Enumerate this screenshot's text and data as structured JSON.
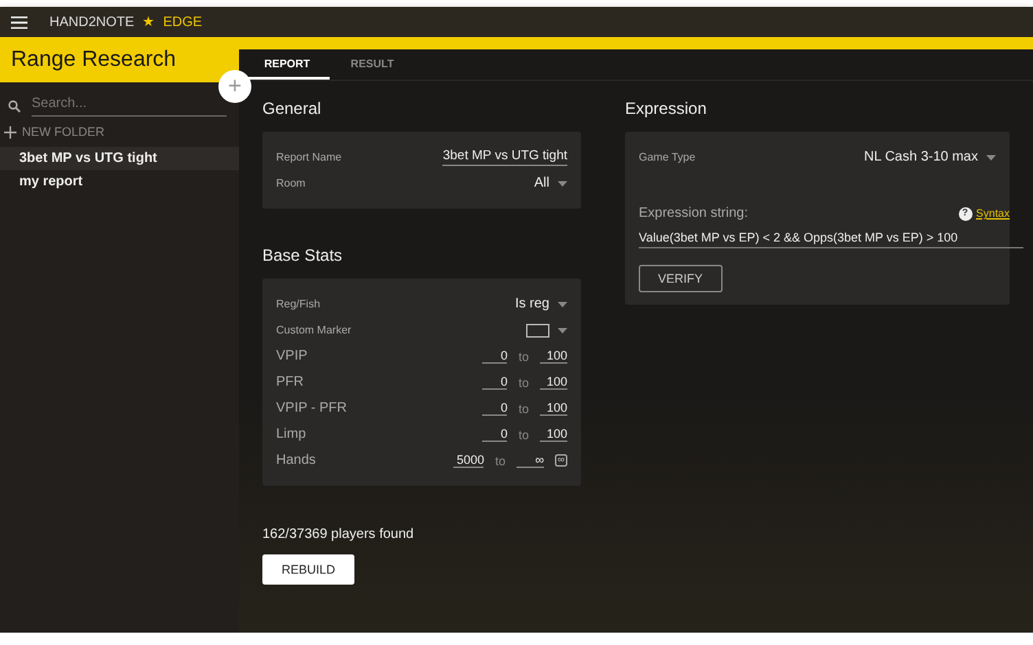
{
  "app": {
    "brand": "HAND2NOTE",
    "star": "★",
    "edition": "EDGE"
  },
  "sidebar": {
    "title": "Range Research",
    "add": "+",
    "search": {
      "placeholder": "Search..."
    },
    "new_folder": "NEW FOLDER",
    "items": [
      {
        "label": "3bet MP vs UTG tight",
        "selected": true
      },
      {
        "label": "my report",
        "selected": false
      }
    ]
  },
  "tabs": [
    {
      "label": "REPORT",
      "selected": true
    },
    {
      "label": "RESULT",
      "selected": false
    }
  ],
  "general": {
    "title": "General",
    "rows": [
      {
        "kind": "text",
        "label": "Report Name",
        "value": "3bet MP vs UTG tight"
      },
      {
        "kind": "select",
        "label": "Room",
        "value": "All"
      }
    ]
  },
  "base_stats": {
    "title": "Base Stats",
    "rows": [
      {
        "kind": "select",
        "label": "Reg/Fish",
        "value": "Is reg"
      },
      {
        "kind": "marker",
        "label": "Custom Marker"
      },
      {
        "kind": "range",
        "label": "VPIP",
        "from": "0",
        "to_word": "to",
        "to": "100"
      },
      {
        "kind": "range",
        "label": "PFR",
        "from": "0",
        "to_word": "to",
        "to": "100"
      },
      {
        "kind": "range",
        "label": "VPIP - PFR",
        "from": "0",
        "to_word": "to",
        "to": "100"
      },
      {
        "kind": "range",
        "label": "Limp",
        "from": "0",
        "to_word": "to",
        "to": "100"
      },
      {
        "kind": "range",
        "label": "Hands",
        "from": "5000",
        "to_word": "to",
        "to": "∞",
        "toggle": "∞"
      }
    ]
  },
  "expression": {
    "title": "Expression",
    "game_type_label": "Game Type",
    "game_type": "NL Cash 3-10 max",
    "string_label": "Expression string:",
    "help": "?",
    "syntax_link": "Syntax",
    "value": "Value(3bet MP vs EP) < 2 && Opps(3bet MP vs EP) > 100",
    "verify": "VERIFY"
  },
  "result": {
    "found": "162/37369 players found",
    "rebuild": "REBUILD"
  }
}
